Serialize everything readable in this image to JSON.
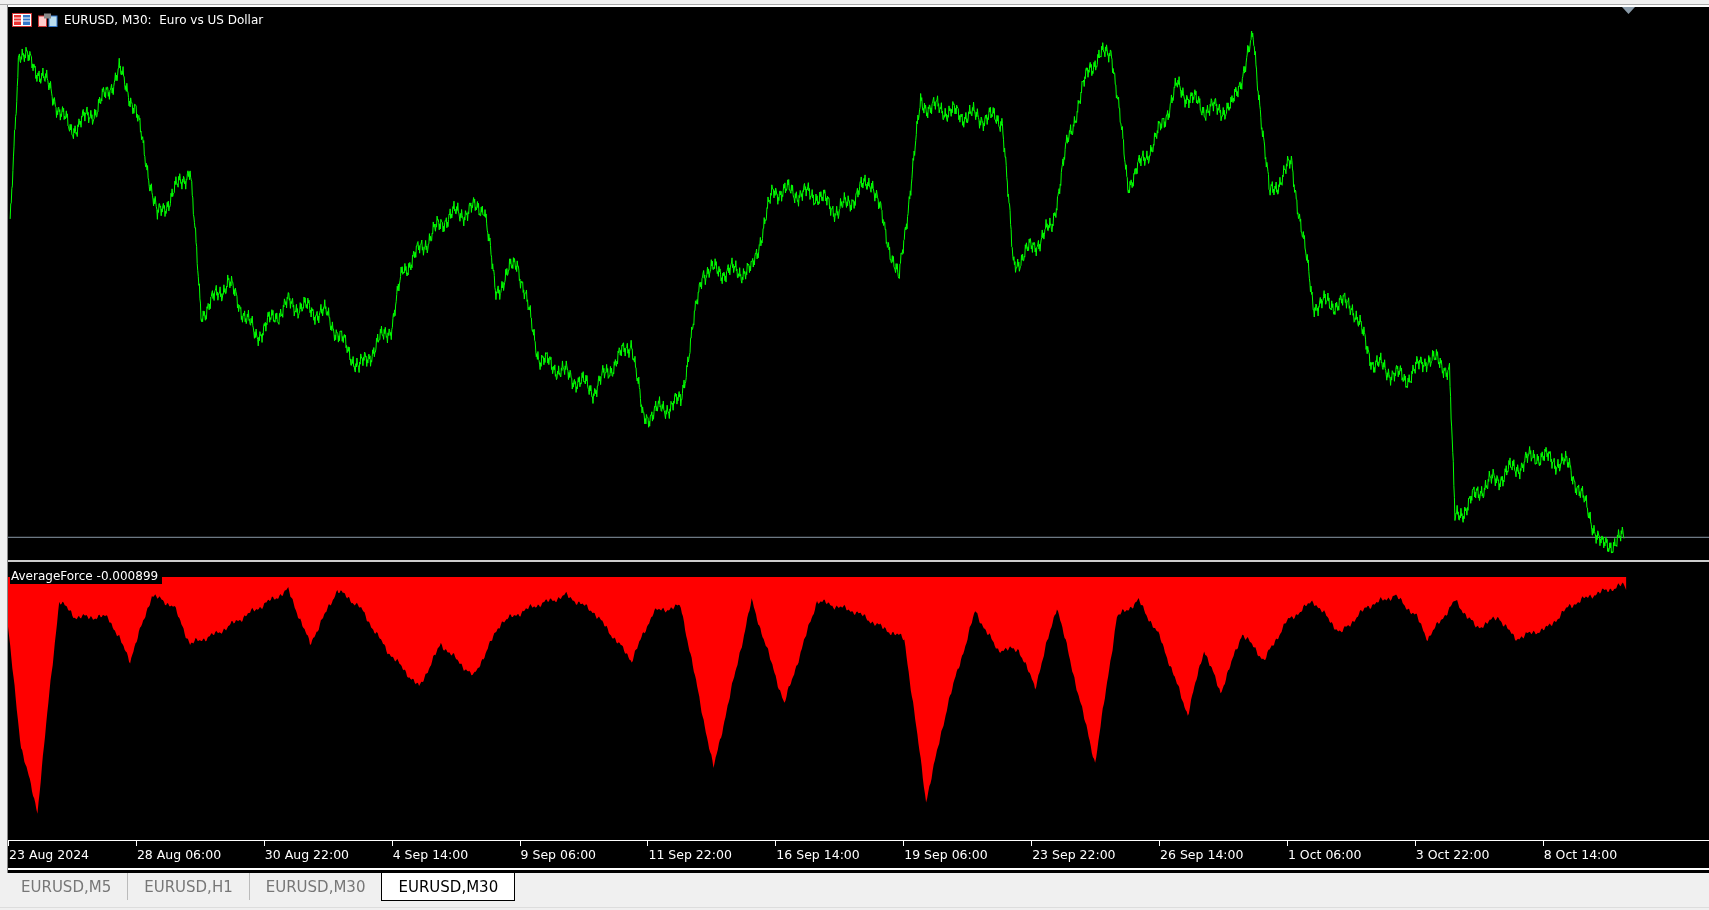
{
  "chart": {
    "title": "EURUSD, M30:  Euro vs US Dollar"
  },
  "indicator": {
    "label": "AverageForce -0.000899"
  },
  "time_axis": {
    "labels": [
      "23 Aug 2024",
      "28 Aug 06:00",
      "30 Aug 22:00",
      "4 Sep 14:00",
      "9 Sep 06:00",
      "11 Sep 22:00",
      "16 Sep 14:00",
      "19 Sep 06:00",
      "23 Sep 22:00",
      "26 Sep 14:00",
      "1 Oct 06:00",
      "3 Oct 22:00",
      "8 Oct 14:00"
    ]
  },
  "tabs": [
    {
      "label": "EURUSD,M5",
      "selected": false
    },
    {
      "label": "EURUSD,H1",
      "selected": false
    },
    {
      "label": "EURUSD,M30",
      "selected": false
    },
    {
      "label": "EURUSD,M30",
      "selected": true
    }
  ]
}
